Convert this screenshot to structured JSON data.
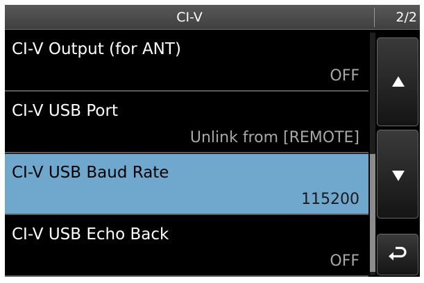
{
  "header": {
    "title": "CI-V",
    "page": "2/2"
  },
  "items": [
    {
      "label": "CI-V Output (for ANT)",
      "value": "OFF",
      "selected": false
    },
    {
      "label": "CI-V USB Port",
      "value": "Unlink from [REMOTE]",
      "selected": false
    },
    {
      "label": "CI-V USB Baud Rate",
      "value": "115200",
      "selected": true
    },
    {
      "label": "CI-V USB Echo Back",
      "value": "OFF",
      "selected": false
    }
  ],
  "buttons": {
    "up_icon": "triangle-up-icon",
    "down_icon": "triangle-down-icon",
    "back_icon": "return-arrow-icon"
  },
  "colors": {
    "background": "#000000",
    "selection": "#6fa8cc",
    "value_text": "#a8a8a8",
    "title_bar": "#4a4a4a"
  }
}
